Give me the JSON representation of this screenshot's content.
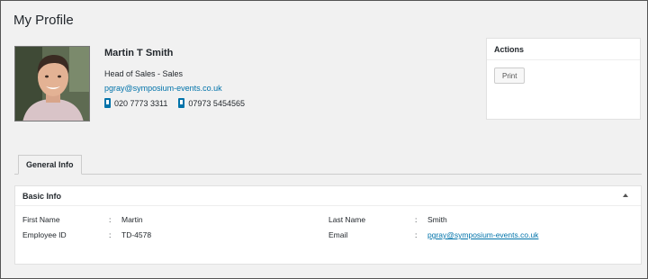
{
  "page": {
    "title": "My Profile"
  },
  "profile": {
    "name": "Martin T Smith",
    "role": "Head of Sales - Sales",
    "email": "pgray@symposium-events.co.uk",
    "phone_office": "020 7773 3311",
    "phone_mobile": "07973 5454565",
    "photo_icon": "profile-photo"
  },
  "actions": {
    "title": "Actions",
    "print_label": "Print"
  },
  "tabs": [
    {
      "label": "General Info",
      "active": true
    }
  ],
  "basic_info": {
    "title": "Basic Info",
    "sep": ":",
    "first_name_label": "First Name",
    "first_name_value": "Martin",
    "last_name_label": "Last Name",
    "last_name_value": "Smith",
    "employee_id_label": "Employee ID",
    "employee_id_value": "TD-4578",
    "email_label": "Email",
    "email_value": "pgray@symposium-events.co.uk"
  },
  "colors": {
    "link": "#0073aa",
    "background": "#f1f1f1",
    "panel": "#ffffff"
  }
}
